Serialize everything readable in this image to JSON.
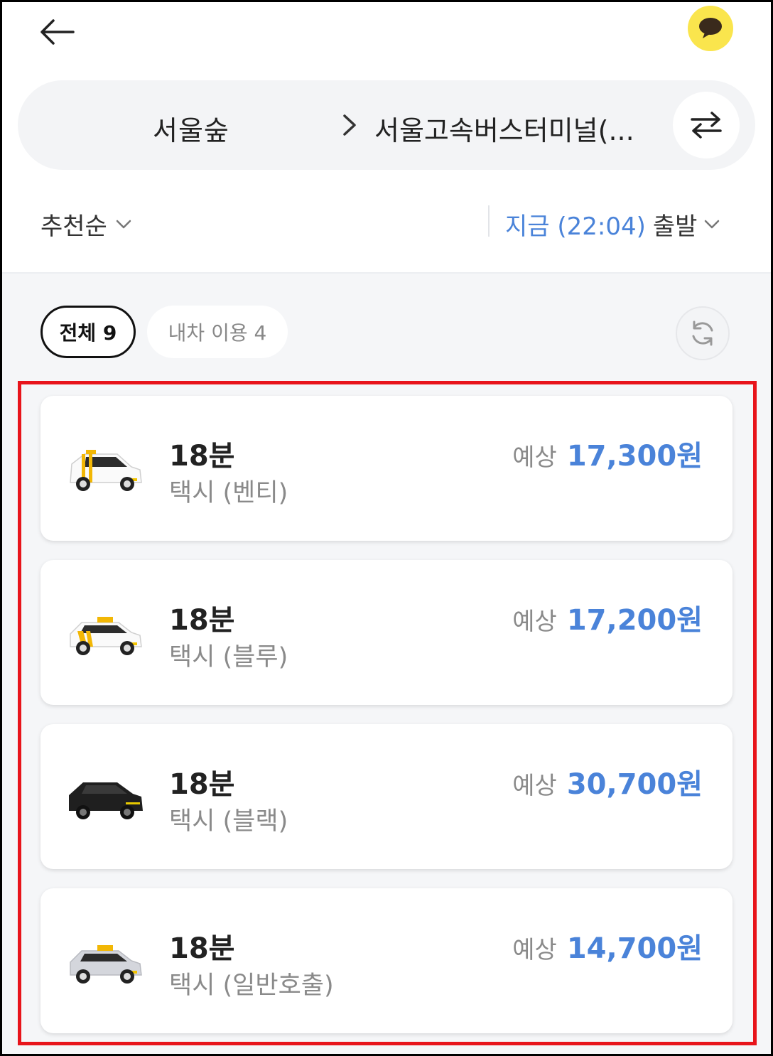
{
  "header": {
    "back_icon": "arrow-left-icon",
    "chat_icon": "speech-bubble-icon",
    "route": {
      "origin": "서울숲",
      "destination": "서울고속버스터미널(...",
      "swap_icon": "swap-arrows-icon"
    },
    "sort_label": "추천순",
    "depart": {
      "time_label": "지금 (22:04)",
      "word": "출발"
    }
  },
  "filters": {
    "all_label": "전체 9",
    "own_car_label": "내차 이용 4",
    "refresh_icon": "refresh-icon"
  },
  "options": [
    {
      "eta": "18분",
      "vehicle": "택시 (벤티)",
      "price_prefix": "예상",
      "price": "17,300원",
      "car_icon": "venti-taxi-icon"
    },
    {
      "eta": "18분",
      "vehicle": "택시 (블루)",
      "price_prefix": "예상",
      "price": "17,200원",
      "car_icon": "blue-taxi-icon"
    },
    {
      "eta": "18분",
      "vehicle": "택시 (블랙)",
      "price_prefix": "예상",
      "price": "30,700원",
      "car_icon": "black-taxi-icon"
    },
    {
      "eta": "18분",
      "vehicle": "택시 (일반호출)",
      "price_prefix": "예상",
      "price": "14,700원",
      "car_icon": "general-taxi-icon"
    }
  ],
  "colors": {
    "accent_blue": "#4a83d9",
    "kakao_yellow": "#fae54d",
    "highlight_red": "#e8141b"
  }
}
